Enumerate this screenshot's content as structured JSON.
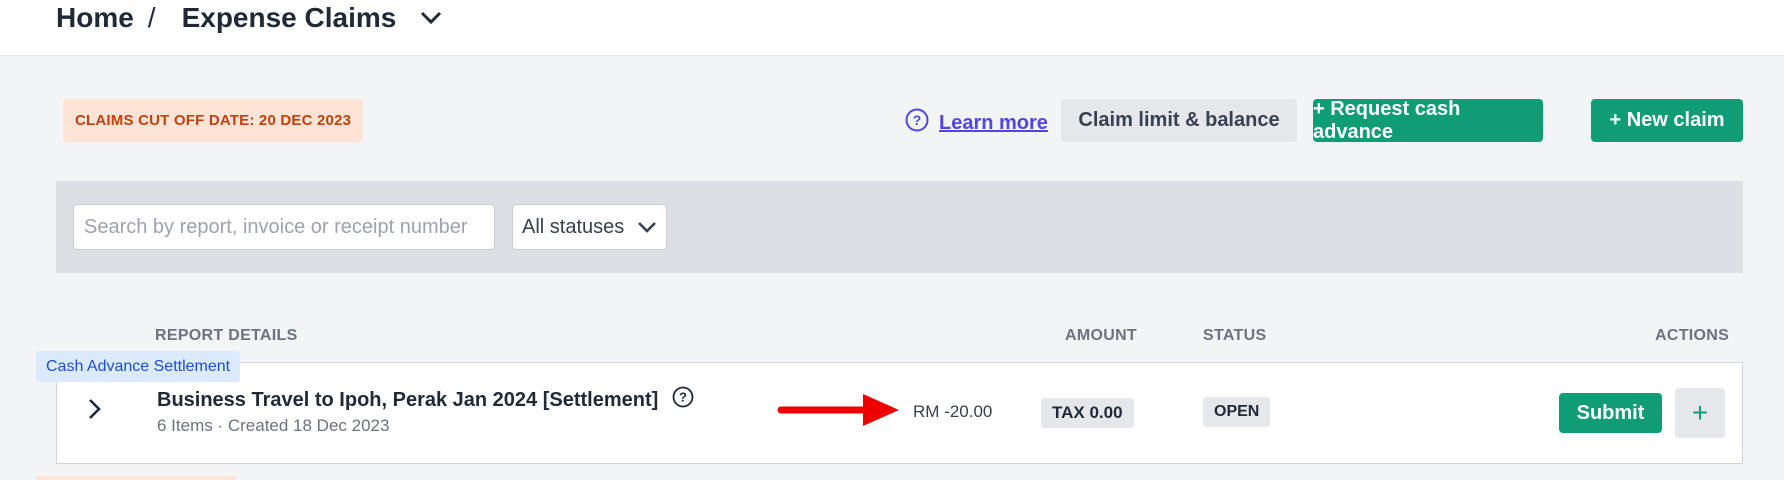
{
  "breadcrumb": {
    "home": "Home",
    "separator": "/",
    "current": "Expense Claims"
  },
  "cutoff": {
    "label": "CLAIMS CUT OFF DATE: 20 DEC 2023"
  },
  "actions": {
    "learn_more": "Learn more",
    "claim_limit": "Claim limit & balance",
    "request_cash": "+ Request cash advance",
    "new_claim": "+ New claim"
  },
  "filters": {
    "search_placeholder": "Search by report, invoice or receipt number",
    "status_selected": "All statuses"
  },
  "table": {
    "headers": {
      "report": "REPORT DETAILS",
      "amount": "AMOUNT",
      "status": "STATUS",
      "actions": "ACTIONS"
    },
    "rows": [
      {
        "tag": "Cash Advance Settlement",
        "title": "Business Travel to Ipoh, Perak Jan 2024 [Settlement]",
        "subtitle": "6 Items · Created 18 Dec 2023",
        "amount": "RM -20.00",
        "tax": "TAX 0.00",
        "status": "OPEN",
        "submit_label": "Submit",
        "add_label": "+"
      }
    ]
  },
  "colors": {
    "accent_green": "#0f9d76",
    "link": "#4f46e5",
    "cutoff_bg": "#fde4d7",
    "cutoff_text": "#c2410c",
    "annotation_arrow": "#ee0000"
  }
}
